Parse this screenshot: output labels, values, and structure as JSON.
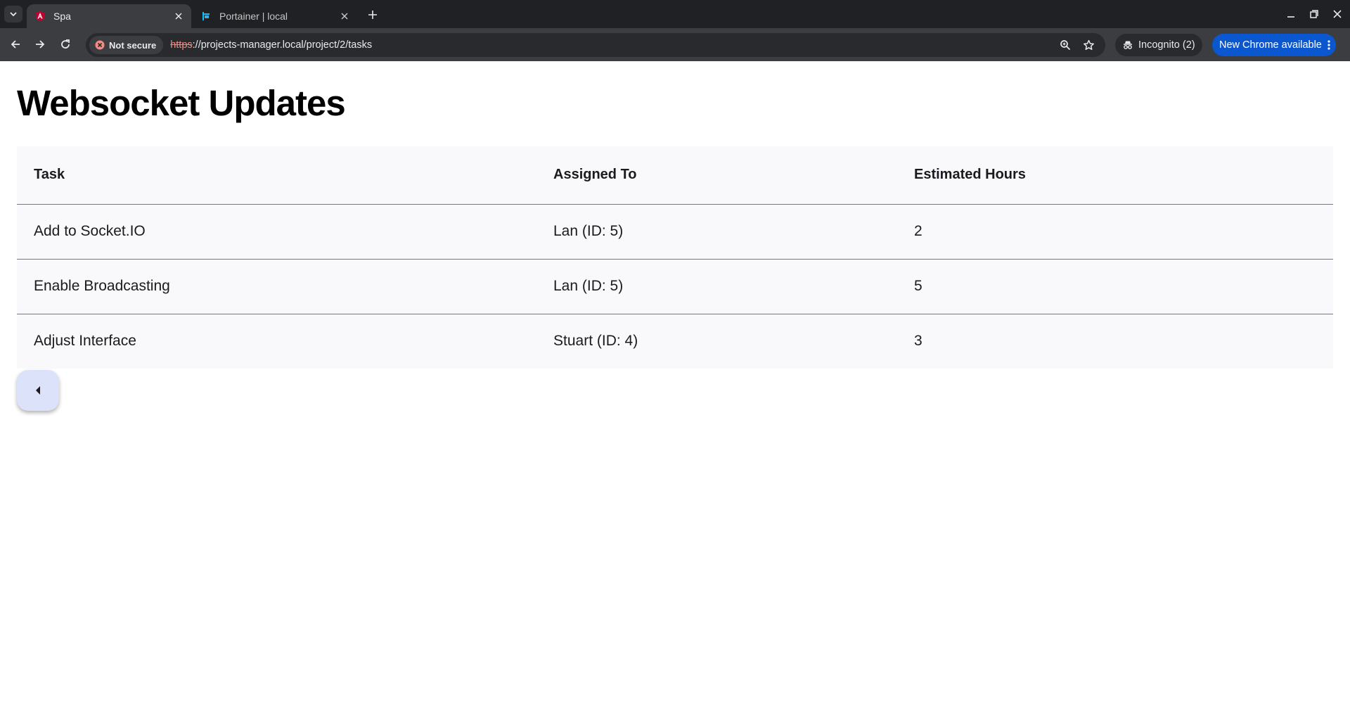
{
  "browser": {
    "tabs": [
      {
        "title": "Spa",
        "active": true,
        "favicon": "angular-logo-icon"
      },
      {
        "title": "Portainer | local",
        "active": false,
        "favicon": "portainer-logo-icon"
      }
    ],
    "security_label": "Not secure",
    "url_scheme": "https",
    "url_rest": "://projects-manager.local/project/2/tasks",
    "incognito_label": "Incognito (2)",
    "update_label": "New Chrome available"
  },
  "page": {
    "title": "Websocket Updates",
    "table": {
      "headers": [
        "Task",
        "Assigned To",
        "Estimated Hours"
      ],
      "rows": [
        [
          "Add to Socket.IO",
          "Lan (ID: 5)",
          "2"
        ],
        [
          "Enable Broadcasting",
          "Lan (ID: 5)",
          "5"
        ],
        [
          "Adjust Interface",
          "Stuart (ID: 4)",
          "3"
        ]
      ]
    },
    "back_button_icon": "caret-left-icon"
  },
  "colors": {
    "chrome_frame": "#202124",
    "toolbar": "#3c3d41",
    "update_chip": "#0b57d0",
    "table_bg": "#f9f9fc",
    "fab_bg": "#dce2f9"
  }
}
